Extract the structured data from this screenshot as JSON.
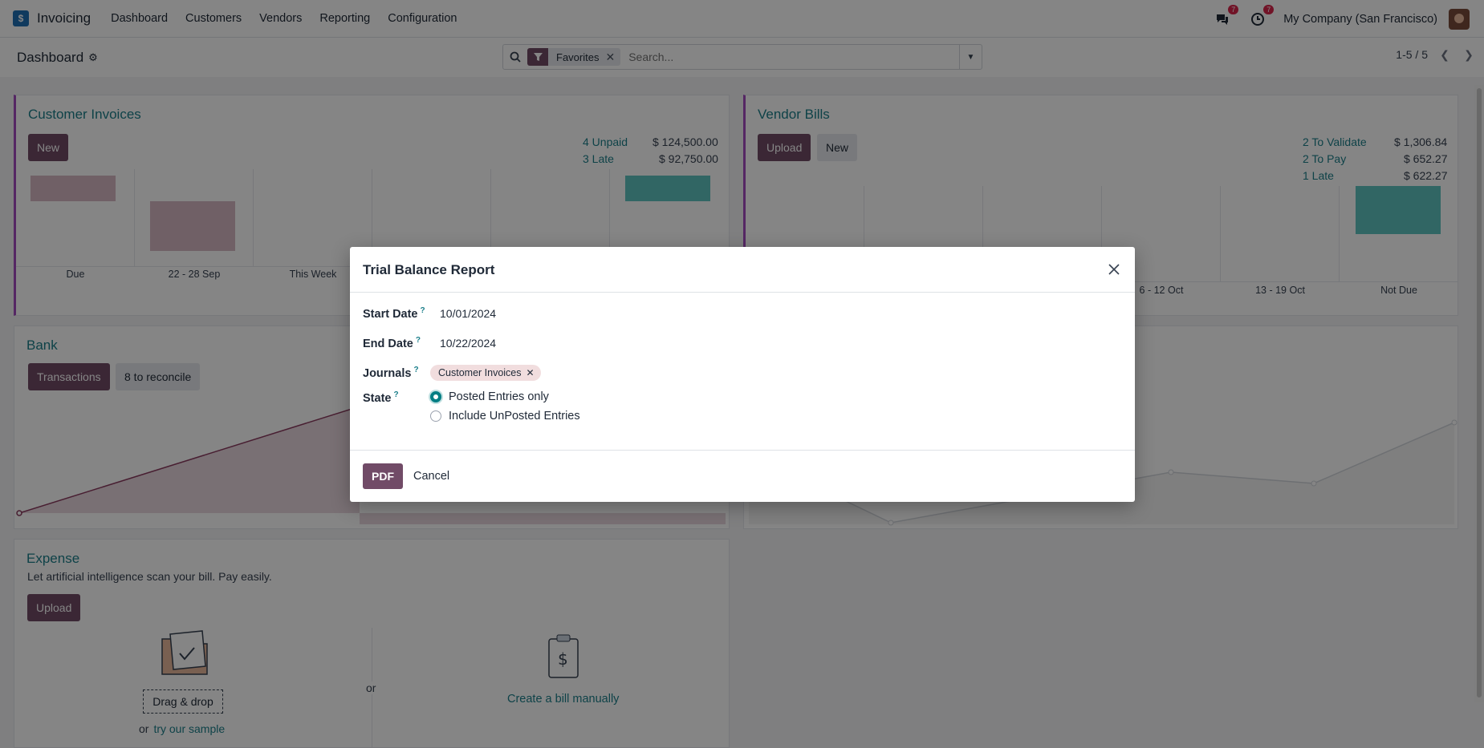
{
  "navbar": {
    "app_name": "Invoicing",
    "menu": [
      "Dashboard",
      "Customers",
      "Vendors",
      "Reporting",
      "Configuration"
    ],
    "messages_badge": "7",
    "activities_badge": "7",
    "company": "My Company (San Francisco)"
  },
  "control": {
    "breadcrumb": "Dashboard",
    "facet_label": "Favorites",
    "search_placeholder": "Search...",
    "pager": "1-5 / 5"
  },
  "customer_invoices": {
    "title": "Customer Invoices",
    "new_label": "New",
    "stats": [
      {
        "label": "4 Unpaid",
        "value": "$ 124,500.00"
      },
      {
        "label": "3 Late",
        "value": "$ 92,750.00"
      }
    ],
    "bar_labels": [
      "Due",
      "22 - 28 Sep",
      "This Week",
      "",
      "",
      ""
    ]
  },
  "vendor_bills": {
    "title": "Vendor Bills",
    "upload_label": "Upload",
    "new_label": "New",
    "stats": [
      {
        "label": "2 To Validate",
        "value": "$ 1,306.84"
      },
      {
        "label": "2 To Pay",
        "value": "$ 652.27"
      },
      {
        "label": "1 Late",
        "value": "$ 622.27"
      }
    ],
    "bar_labels": [
      "",
      "",
      "",
      "6 - 12 Oct",
      "13 - 19 Oct",
      "Not Due"
    ]
  },
  "bank": {
    "title": "Bank",
    "transactions_label": "Transactions",
    "reconcile_label": "8 to reconcile"
  },
  "expense": {
    "title": "Expense",
    "subtitle": "Let artificial intelligence scan your bill. Pay easily.",
    "upload_label": "Upload",
    "drag_drop": "Drag & drop",
    "or_label": "or",
    "sample_prefix": "or",
    "sample_link": "try our sample",
    "create_manual": "Create a bill manually"
  },
  "modal": {
    "title": "Trial Balance Report",
    "start_date_label": "Start Date",
    "start_date": "10/01/2024",
    "end_date_label": "End Date",
    "end_date": "10/22/2024",
    "journals_label": "Journals",
    "journal_tag": "Customer Invoices",
    "state_label": "State",
    "state_options": [
      "Posted Entries only",
      "Include UnPosted Entries"
    ],
    "state_selected": "Posted Entries only",
    "pdf_label": "PDF",
    "cancel_label": "Cancel",
    "help_mark": "?"
  },
  "colors": {
    "primary": "#714b67",
    "accent_teal": "#1b7f8a",
    "bar_teal": "#5ec4c0",
    "bar_pink": "#d7b9c4"
  }
}
